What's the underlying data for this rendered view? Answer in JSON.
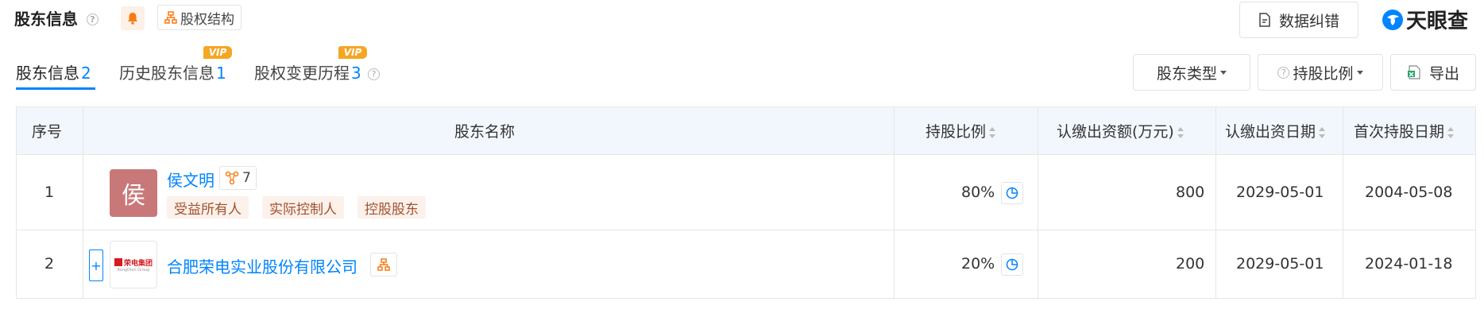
{
  "header": {
    "title": "股东信息",
    "help_mark": "?",
    "structure_label": "股权结构",
    "report_error_label": "数据纠错",
    "brand": "天眼查"
  },
  "tabs": [
    {
      "label": "股东信息",
      "count": "2"
    },
    {
      "label": "历史股东信息",
      "count": "1",
      "badge": "VIP"
    },
    {
      "label": "股权变更历程",
      "count": "3",
      "badge": "VIP"
    }
  ],
  "toolbar": {
    "type_filter": "股东类型",
    "ratio_filter": "持股比例",
    "export_label": "导出"
  },
  "table": {
    "columns": [
      "序号",
      "股东名称",
      "持股比例",
      "认缴出资额(万元)",
      "认缴出资日期",
      "首次持股日期"
    ],
    "rows": [
      {
        "index": "1",
        "avatar_char": "侯",
        "name": "侯文明",
        "relation_count": "7",
        "tags": [
          "受益所有人",
          "实际控制人",
          "控股股东"
        ],
        "ratio": "80%",
        "amount": "800",
        "subscribe_date": "2029-05-01",
        "first_date": "2004-05-08"
      },
      {
        "index": "2",
        "expand": "+",
        "logo_text": "荣电集团",
        "logo_sub": "RongDian Group",
        "name": "合肥荣电实业股份有限公司",
        "ratio": "20%",
        "amount": "200",
        "subscribe_date": "2029-05-01",
        "first_date": "2024-01-18"
      }
    ]
  },
  "colors": {
    "accent": "#0084ff",
    "vip": "#f5a623",
    "avatar_bg": "#c9787a",
    "tag_bg": "#fdf1ec",
    "tag_text": "#a0522d"
  }
}
